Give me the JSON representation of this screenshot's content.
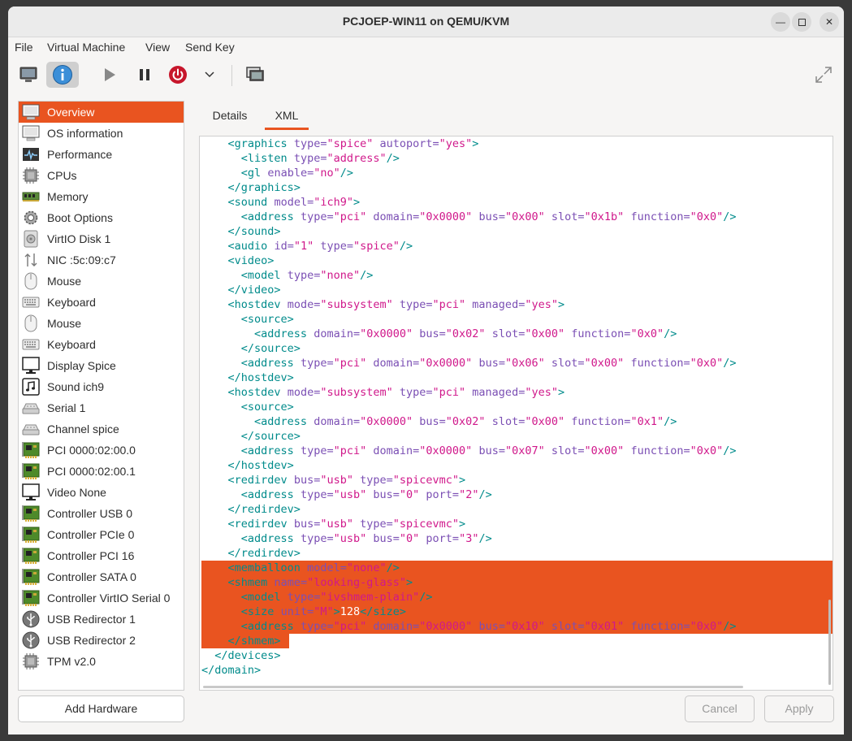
{
  "window": {
    "title": "PCJOEP-WIN11 on QEMU/KVM"
  },
  "menu": [
    "File",
    "Virtual Machine",
    "View",
    "Send Key"
  ],
  "toolbar": {
    "icons": [
      "monitor-icon",
      "info-icon",
      "play-icon",
      "pause-icon",
      "power-icon",
      "chevron-down-icon",
      "screenshot-icon",
      "fullscreen-icon"
    ],
    "accent": "#e95420"
  },
  "sidebar": {
    "items": [
      {
        "label": "Overview",
        "icon": "monitor-icon"
      },
      {
        "label": "OS information",
        "icon": "monitor-icon"
      },
      {
        "label": "Performance",
        "icon": "performance-icon"
      },
      {
        "label": "CPUs",
        "icon": "cpu-icon"
      },
      {
        "label": "Memory",
        "icon": "memory-icon"
      },
      {
        "label": "Boot Options",
        "icon": "gear-icon"
      },
      {
        "label": "VirtIO Disk 1",
        "icon": "disk-icon"
      },
      {
        "label": "NIC :5c:09:c7",
        "icon": "network-icon"
      },
      {
        "label": "Mouse",
        "icon": "mouse-icon"
      },
      {
        "label": "Keyboard",
        "icon": "keyboard-icon"
      },
      {
        "label": "Mouse",
        "icon": "mouse-icon"
      },
      {
        "label": "Keyboard",
        "icon": "keyboard-icon"
      },
      {
        "label": "Display Spice",
        "icon": "display-icon"
      },
      {
        "label": "Sound ich9",
        "icon": "sound-icon"
      },
      {
        "label": "Serial 1",
        "icon": "serial-icon"
      },
      {
        "label": "Channel spice",
        "icon": "serial-icon"
      },
      {
        "label": "PCI 0000:02:00.0",
        "icon": "pci-card-icon"
      },
      {
        "label": "PCI 0000:02:00.1",
        "icon": "pci-card-icon"
      },
      {
        "label": "Video None",
        "icon": "display-icon"
      },
      {
        "label": "Controller USB 0",
        "icon": "pci-card-icon"
      },
      {
        "label": "Controller PCIe 0",
        "icon": "pci-card-icon"
      },
      {
        "label": "Controller PCI 16",
        "icon": "pci-card-icon"
      },
      {
        "label": "Controller SATA 0",
        "icon": "pci-card-icon"
      },
      {
        "label": "Controller VirtIO Serial 0",
        "icon": "pci-card-icon"
      },
      {
        "label": "USB Redirector 1",
        "icon": "usb-icon"
      },
      {
        "label": "USB Redirector 2",
        "icon": "usb-icon"
      },
      {
        "label": "TPM v2.0",
        "icon": "cpu-icon"
      }
    ],
    "selected": "Overview",
    "add_hardware_label": "Add Hardware"
  },
  "tabs": [
    {
      "label": "Details",
      "active": false
    },
    {
      "label": "XML",
      "active": true
    }
  ],
  "xml": {
    "lines": [
      {
        "indent": 4,
        "tokens": [
          [
            "t",
            "<graphics"
          ],
          [
            "s",
            " "
          ],
          [
            "a",
            "type="
          ],
          [
            "v",
            "\"spice\""
          ],
          [
            "s",
            " "
          ],
          [
            "a",
            "autoport="
          ],
          [
            "v",
            "\"yes\""
          ],
          [
            "t",
            ">"
          ]
        ]
      },
      {
        "indent": 6,
        "tokens": [
          [
            "t",
            "<listen"
          ],
          [
            "s",
            " "
          ],
          [
            "a",
            "type="
          ],
          [
            "v",
            "\"address\""
          ],
          [
            "t",
            "/>"
          ]
        ]
      },
      {
        "indent": 6,
        "tokens": [
          [
            "t",
            "<gl"
          ],
          [
            "s",
            " "
          ],
          [
            "a",
            "enable="
          ],
          [
            "v",
            "\"no\""
          ],
          [
            "t",
            "/>"
          ]
        ]
      },
      {
        "indent": 4,
        "tokens": [
          [
            "t",
            "</graphics>"
          ]
        ]
      },
      {
        "indent": 4,
        "tokens": [
          [
            "t",
            "<sound"
          ],
          [
            "s",
            " "
          ],
          [
            "a",
            "model="
          ],
          [
            "v",
            "\"ich9\""
          ],
          [
            "t",
            ">"
          ]
        ]
      },
      {
        "indent": 6,
        "tokens": [
          [
            "t",
            "<address"
          ],
          [
            "s",
            " "
          ],
          [
            "a",
            "type="
          ],
          [
            "v",
            "\"pci\""
          ],
          [
            "s",
            " "
          ],
          [
            "a",
            "domain="
          ],
          [
            "v",
            "\"0x0000\""
          ],
          [
            "s",
            " "
          ],
          [
            "a",
            "bus="
          ],
          [
            "v",
            "\"0x00\""
          ],
          [
            "s",
            " "
          ],
          [
            "a",
            "slot="
          ],
          [
            "v",
            "\"0x1b\""
          ],
          [
            "s",
            " "
          ],
          [
            "a",
            "function="
          ],
          [
            "v",
            "\"0x0\""
          ],
          [
            "t",
            "/>"
          ]
        ]
      },
      {
        "indent": 4,
        "tokens": [
          [
            "t",
            "</sound>"
          ]
        ]
      },
      {
        "indent": 4,
        "tokens": [
          [
            "t",
            "<audio"
          ],
          [
            "s",
            " "
          ],
          [
            "a",
            "id="
          ],
          [
            "v",
            "\"1\""
          ],
          [
            "s",
            " "
          ],
          [
            "a",
            "type="
          ],
          [
            "v",
            "\"spice\""
          ],
          [
            "t",
            "/>"
          ]
        ]
      },
      {
        "indent": 4,
        "tokens": [
          [
            "t",
            "<video>"
          ]
        ]
      },
      {
        "indent": 6,
        "tokens": [
          [
            "t",
            "<model"
          ],
          [
            "s",
            " "
          ],
          [
            "a",
            "type="
          ],
          [
            "v",
            "\"none\""
          ],
          [
            "t",
            "/>"
          ]
        ]
      },
      {
        "indent": 4,
        "tokens": [
          [
            "t",
            "</video>"
          ]
        ]
      },
      {
        "indent": 4,
        "tokens": [
          [
            "t",
            "<hostdev"
          ],
          [
            "s",
            " "
          ],
          [
            "a",
            "mode="
          ],
          [
            "v",
            "\"subsystem\""
          ],
          [
            "s",
            " "
          ],
          [
            "a",
            "type="
          ],
          [
            "v",
            "\"pci\""
          ],
          [
            "s",
            " "
          ],
          [
            "a",
            "managed="
          ],
          [
            "v",
            "\"yes\""
          ],
          [
            "t",
            ">"
          ]
        ]
      },
      {
        "indent": 6,
        "tokens": [
          [
            "t",
            "<source>"
          ]
        ]
      },
      {
        "indent": 8,
        "tokens": [
          [
            "t",
            "<address"
          ],
          [
            "s",
            " "
          ],
          [
            "a",
            "domain="
          ],
          [
            "v",
            "\"0x0000\""
          ],
          [
            "s",
            " "
          ],
          [
            "a",
            "bus="
          ],
          [
            "v",
            "\"0x02\""
          ],
          [
            "s",
            " "
          ],
          [
            "a",
            "slot="
          ],
          [
            "v",
            "\"0x00\""
          ],
          [
            "s",
            " "
          ],
          [
            "a",
            "function="
          ],
          [
            "v",
            "\"0x0\""
          ],
          [
            "t",
            "/>"
          ]
        ]
      },
      {
        "indent": 6,
        "tokens": [
          [
            "t",
            "</source>"
          ]
        ]
      },
      {
        "indent": 6,
        "tokens": [
          [
            "t",
            "<address"
          ],
          [
            "s",
            " "
          ],
          [
            "a",
            "type="
          ],
          [
            "v",
            "\"pci\""
          ],
          [
            "s",
            " "
          ],
          [
            "a",
            "domain="
          ],
          [
            "v",
            "\"0x0000\""
          ],
          [
            "s",
            " "
          ],
          [
            "a",
            "bus="
          ],
          [
            "v",
            "\"0x06\""
          ],
          [
            "s",
            " "
          ],
          [
            "a",
            "slot="
          ],
          [
            "v",
            "\"0x00\""
          ],
          [
            "s",
            " "
          ],
          [
            "a",
            "function="
          ],
          [
            "v",
            "\"0x0\""
          ],
          [
            "t",
            "/>"
          ]
        ]
      },
      {
        "indent": 4,
        "tokens": [
          [
            "t",
            "</hostdev>"
          ]
        ]
      },
      {
        "indent": 4,
        "tokens": [
          [
            "t",
            "<hostdev"
          ],
          [
            "s",
            " "
          ],
          [
            "a",
            "mode="
          ],
          [
            "v",
            "\"subsystem\""
          ],
          [
            "s",
            " "
          ],
          [
            "a",
            "type="
          ],
          [
            "v",
            "\"pci\""
          ],
          [
            "s",
            " "
          ],
          [
            "a",
            "managed="
          ],
          [
            "v",
            "\"yes\""
          ],
          [
            "t",
            ">"
          ]
        ]
      },
      {
        "indent": 6,
        "tokens": [
          [
            "t",
            "<source>"
          ]
        ]
      },
      {
        "indent": 8,
        "tokens": [
          [
            "t",
            "<address"
          ],
          [
            "s",
            " "
          ],
          [
            "a",
            "domain="
          ],
          [
            "v",
            "\"0x0000\""
          ],
          [
            "s",
            " "
          ],
          [
            "a",
            "bus="
          ],
          [
            "v",
            "\"0x02\""
          ],
          [
            "s",
            " "
          ],
          [
            "a",
            "slot="
          ],
          [
            "v",
            "\"0x00\""
          ],
          [
            "s",
            " "
          ],
          [
            "a",
            "function="
          ],
          [
            "v",
            "\"0x1\""
          ],
          [
            "t",
            "/>"
          ]
        ]
      },
      {
        "indent": 6,
        "tokens": [
          [
            "t",
            "</source>"
          ]
        ]
      },
      {
        "indent": 6,
        "tokens": [
          [
            "t",
            "<address"
          ],
          [
            "s",
            " "
          ],
          [
            "a",
            "type="
          ],
          [
            "v",
            "\"pci\""
          ],
          [
            "s",
            " "
          ],
          [
            "a",
            "domain="
          ],
          [
            "v",
            "\"0x0000\""
          ],
          [
            "s",
            " "
          ],
          [
            "a",
            "bus="
          ],
          [
            "v",
            "\"0x07\""
          ],
          [
            "s",
            " "
          ],
          [
            "a",
            "slot="
          ],
          [
            "v",
            "\"0x00\""
          ],
          [
            "s",
            " "
          ],
          [
            "a",
            "function="
          ],
          [
            "v",
            "\"0x0\""
          ],
          [
            "t",
            "/>"
          ]
        ]
      },
      {
        "indent": 4,
        "tokens": [
          [
            "t",
            "</hostdev>"
          ]
        ]
      },
      {
        "indent": 4,
        "tokens": [
          [
            "t",
            "<redirdev"
          ],
          [
            "s",
            " "
          ],
          [
            "a",
            "bus="
          ],
          [
            "v",
            "\"usb\""
          ],
          [
            "s",
            " "
          ],
          [
            "a",
            "type="
          ],
          [
            "v",
            "\"spicevmc\""
          ],
          [
            "t",
            ">"
          ]
        ]
      },
      {
        "indent": 6,
        "tokens": [
          [
            "t",
            "<address"
          ],
          [
            "s",
            " "
          ],
          [
            "a",
            "type="
          ],
          [
            "v",
            "\"usb\""
          ],
          [
            "s",
            " "
          ],
          [
            "a",
            "bus="
          ],
          [
            "v",
            "\"0\""
          ],
          [
            "s",
            " "
          ],
          [
            "a",
            "port="
          ],
          [
            "v",
            "\"2\""
          ],
          [
            "t",
            "/>"
          ]
        ]
      },
      {
        "indent": 4,
        "tokens": [
          [
            "t",
            "</redirdev>"
          ]
        ]
      },
      {
        "indent": 4,
        "tokens": [
          [
            "t",
            "<redirdev"
          ],
          [
            "s",
            " "
          ],
          [
            "a",
            "bus="
          ],
          [
            "v",
            "\"usb\""
          ],
          [
            "s",
            " "
          ],
          [
            "a",
            "type="
          ],
          [
            "v",
            "\"spicevmc\""
          ],
          [
            "t",
            ">"
          ]
        ]
      },
      {
        "indent": 6,
        "tokens": [
          [
            "t",
            "<address"
          ],
          [
            "s",
            " "
          ],
          [
            "a",
            "type="
          ],
          [
            "v",
            "\"usb\""
          ],
          [
            "s",
            " "
          ],
          [
            "a",
            "bus="
          ],
          [
            "v",
            "\"0\""
          ],
          [
            "s",
            " "
          ],
          [
            "a",
            "port="
          ],
          [
            "v",
            "\"3\""
          ],
          [
            "t",
            "/>"
          ]
        ]
      },
      {
        "indent": 4,
        "tokens": [
          [
            "t",
            "</redirdev>"
          ]
        ]
      },
      {
        "indent": 4,
        "sel": true,
        "tokens": [
          [
            "t",
            "<memballoon"
          ],
          [
            "s",
            " "
          ],
          [
            "a",
            "model="
          ],
          [
            "v",
            "\"none\""
          ],
          [
            "t",
            "/>"
          ]
        ]
      },
      {
        "indent": 4,
        "sel": true,
        "tokens": [
          [
            "t",
            "<shmem"
          ],
          [
            "s",
            " "
          ],
          [
            "a",
            "name="
          ],
          [
            "v",
            "\"looking-glass\""
          ],
          [
            "t",
            ">"
          ]
        ]
      },
      {
        "indent": 6,
        "sel": true,
        "tokens": [
          [
            "t",
            "<model"
          ],
          [
            "s",
            " "
          ],
          [
            "a",
            "type="
          ],
          [
            "v",
            "\"ivshmem-plain\""
          ],
          [
            "t",
            "/>"
          ]
        ]
      },
      {
        "indent": 6,
        "sel": true,
        "tokens": [
          [
            "t",
            "<size"
          ],
          [
            "s",
            " "
          ],
          [
            "a",
            "unit="
          ],
          [
            "v",
            "\"M\""
          ],
          [
            "t",
            ">"
          ],
          [
            "s",
            "128"
          ],
          [
            "t",
            "</size>"
          ]
        ]
      },
      {
        "indent": 6,
        "sel": true,
        "tokens": [
          [
            "t",
            "<address"
          ],
          [
            "s",
            " "
          ],
          [
            "a",
            "type="
          ],
          [
            "v",
            "\"pci\""
          ],
          [
            "s",
            " "
          ],
          [
            "a",
            "domain="
          ],
          [
            "v",
            "\"0x0000\""
          ],
          [
            "s",
            " "
          ],
          [
            "a",
            "bus="
          ],
          [
            "v",
            "\"0x10\""
          ],
          [
            "s",
            " "
          ],
          [
            "a",
            "slot="
          ],
          [
            "v",
            "\"0x01\""
          ],
          [
            "s",
            " "
          ],
          [
            "a",
            "function="
          ],
          [
            "v",
            "\"0x0\""
          ],
          [
            "t",
            "/>"
          ]
        ]
      },
      {
        "indent": 4,
        "sel": true,
        "partial": true,
        "tokens": [
          [
            "t",
            "</shmem>"
          ]
        ]
      },
      {
        "indent": 2,
        "tokens": [
          [
            "t",
            "</devices>"
          ]
        ]
      },
      {
        "indent": 0,
        "tokens": [
          [
            "t",
            "</domain>"
          ]
        ]
      }
    ]
  },
  "buttons": {
    "cancel": "Cancel",
    "apply": "Apply"
  }
}
